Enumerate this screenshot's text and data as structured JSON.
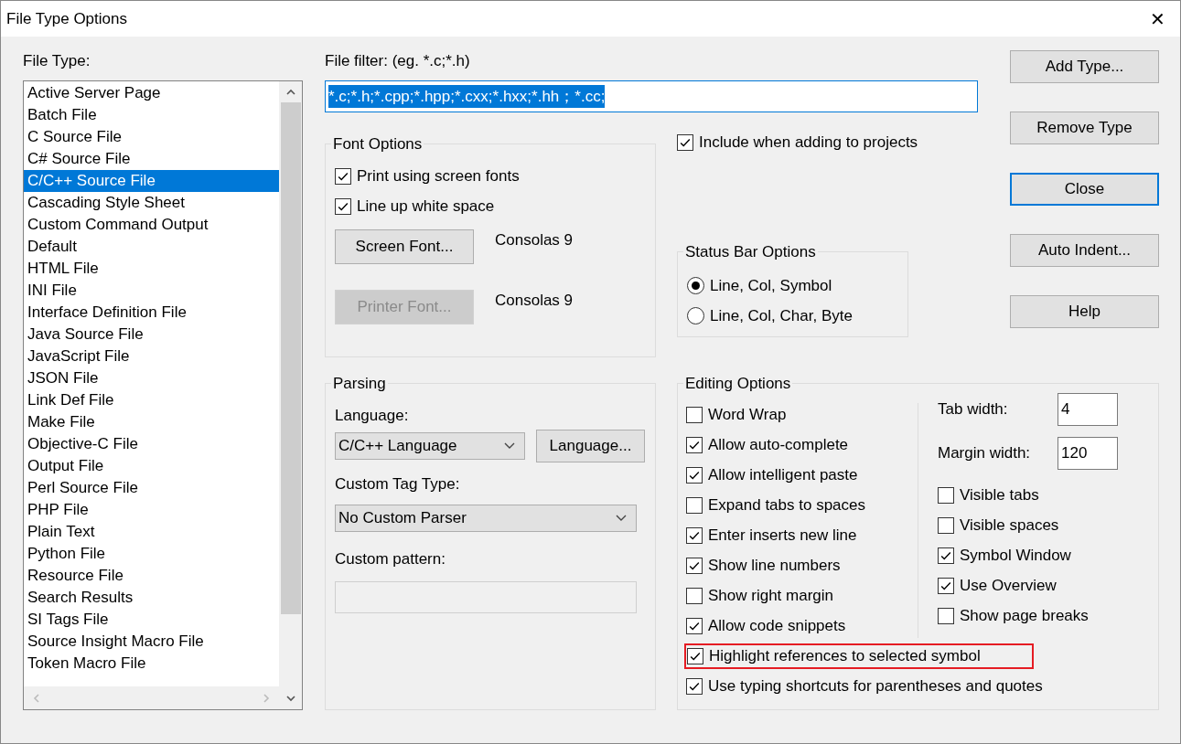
{
  "window": {
    "title": "File Type Options",
    "close": "✕"
  },
  "file_type": {
    "label": "File Type:",
    "items": [
      {
        "label": "Active Server Page",
        "selected": false
      },
      {
        "label": "Batch File",
        "selected": false
      },
      {
        "label": "C Source File",
        "selected": false
      },
      {
        "label": "C# Source File",
        "selected": false
      },
      {
        "label": "C/C++ Source File",
        "selected": true
      },
      {
        "label": "Cascading Style Sheet",
        "selected": false
      },
      {
        "label": "Custom Command Output",
        "selected": false
      },
      {
        "label": "Default",
        "selected": false
      },
      {
        "label": "HTML File",
        "selected": false
      },
      {
        "label": "INI File",
        "selected": false
      },
      {
        "label": "Interface Definition File",
        "selected": false
      },
      {
        "label": "Java Source File",
        "selected": false
      },
      {
        "label": "JavaScript File",
        "selected": false
      },
      {
        "label": "JSON File",
        "selected": false
      },
      {
        "label": "Link Def File",
        "selected": false
      },
      {
        "label": "Make File",
        "selected": false
      },
      {
        "label": "Objective-C File",
        "selected": false
      },
      {
        "label": "Output File",
        "selected": false
      },
      {
        "label": "Perl Source File",
        "selected": false
      },
      {
        "label": "PHP File",
        "selected": false
      },
      {
        "label": "Plain Text",
        "selected": false
      },
      {
        "label": "Python File",
        "selected": false
      },
      {
        "label": "Resource File",
        "selected": false
      },
      {
        "label": "Search Results",
        "selected": false
      },
      {
        "label": "SI Tags File",
        "selected": false
      },
      {
        "label": "Source Insight Macro File",
        "selected": false
      },
      {
        "label": "Token Macro File",
        "selected": false
      }
    ]
  },
  "file_filter": {
    "label": "File filter: (eg. *.c;*.h)",
    "value": "*.c;*.h;*.cpp;*.hpp;*.cxx;*.hxx;*.hh；*.cc;",
    "selected": true
  },
  "font_options": {
    "title": "Font Options",
    "checkboxes": [
      {
        "label": "Print using screen fonts",
        "checked": true
      },
      {
        "label": "Line up white space",
        "checked": true
      }
    ],
    "fonts": [
      {
        "button": "Screen Font...",
        "disabled": false,
        "value": "Consolas 9"
      },
      {
        "button": "Printer Font...",
        "disabled": true,
        "value": "Consolas 9"
      }
    ]
  },
  "include_when_adding": {
    "label": "Include when adding to projects",
    "checked": true
  },
  "status_bar_options": {
    "title": "Status Bar Options",
    "radios": [
      {
        "label": "Line, Col, Symbol",
        "selected": true
      },
      {
        "label": "Line, Col, Char, Byte",
        "selected": false
      }
    ]
  },
  "buttons": [
    {
      "label": "Add Type...",
      "default": false
    },
    {
      "label": "Remove Type",
      "default": false
    },
    {
      "label": "Close",
      "default": true
    },
    {
      "label": "Auto Indent...",
      "default": false
    },
    {
      "label": "Help",
      "default": false
    }
  ],
  "parsing": {
    "title": "Parsing",
    "language_label": "Language:",
    "language": "C/C++ Language",
    "language_button": "Language...",
    "tag_type_label": "Custom Tag Type:",
    "tag_type": "No Custom Parser",
    "pattern_label": "Custom pattern:"
  },
  "editing_options": {
    "title": "Editing Options",
    "left": [
      {
        "label": "Word Wrap",
        "checked": false
      },
      {
        "label": "Allow auto-complete",
        "checked": true
      },
      {
        "label": "Allow intelligent paste",
        "checked": true
      },
      {
        "label": "Expand tabs to spaces",
        "checked": false
      },
      {
        "label": "Enter inserts new line",
        "checked": true
      },
      {
        "label": "Show line numbers",
        "checked": true
      },
      {
        "label": "Show right margin",
        "checked": false
      },
      {
        "label": "Allow code snippets",
        "checked": true
      }
    ],
    "fields": [
      {
        "label": "Tab width:",
        "value": "4"
      },
      {
        "label": "Margin width:",
        "value": "120"
      }
    ],
    "right": [
      {
        "label": "Visible tabs",
        "checked": false
      },
      {
        "label": "Visible spaces",
        "checked": false
      },
      {
        "label": "Symbol Window",
        "checked": true
      },
      {
        "label": "Use Overview",
        "checked": true
      },
      {
        "label": "Show page breaks",
        "checked": false
      }
    ],
    "bottom": [
      {
        "label": "Highlight references to selected symbol",
        "checked": true,
        "highlighted": true
      },
      {
        "label": "Use typing shortcuts for parentheses and quotes",
        "checked": true,
        "highlighted": false
      }
    ]
  }
}
